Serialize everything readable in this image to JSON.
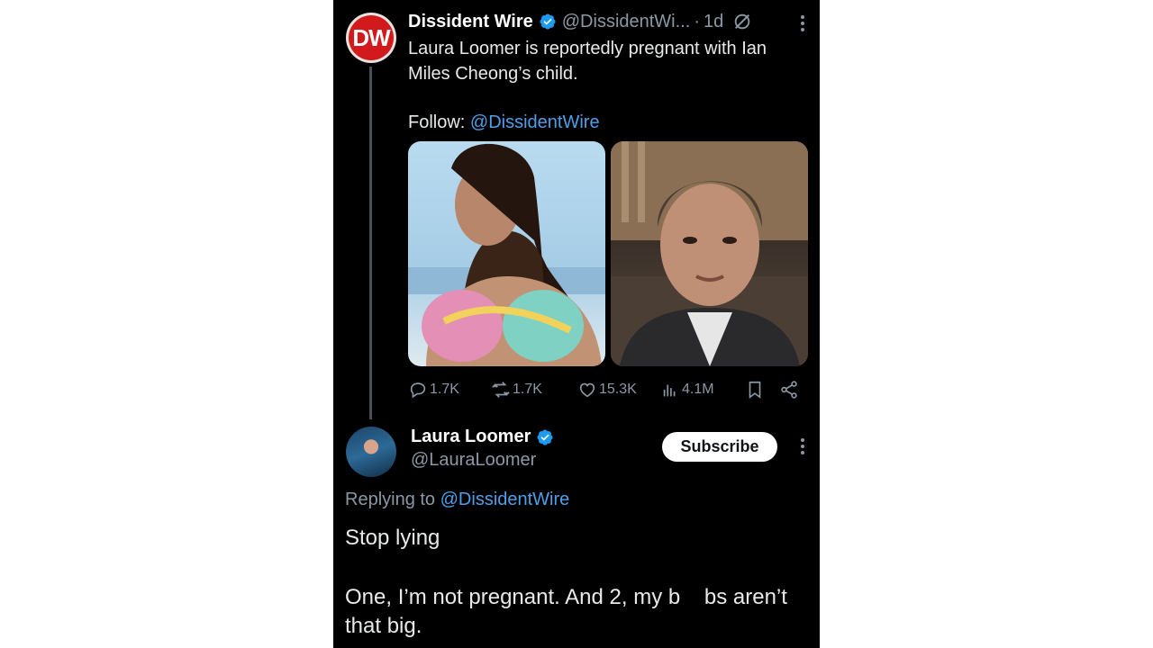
{
  "tweet": {
    "avatar_text": "DW",
    "author_name": "Dissident Wire",
    "author_handle": "@DissidentWi...",
    "separator": "·",
    "time": "1d",
    "text_line1": "Laura Loomer is reportedly pregnant with Ian",
    "text_line2": "Miles Cheong’s child.",
    "follow_prefix": "Follow: ",
    "follow_link": "@DissidentWire",
    "stats": {
      "replies": "1.7K",
      "reposts": "1.7K",
      "likes": "15.3K",
      "views": "4.1M"
    }
  },
  "reply": {
    "author_name": "Laura Loomer",
    "author_handle": "@LauraLoomer",
    "subscribe_label": "Subscribe",
    "replying_prefix": "Replying to ",
    "replying_link": "@DissidentWire",
    "text_line1": "Stop lying",
    "text_line2": "One, I’m not pregnant. And 2, my b    bs aren’t that big."
  },
  "colors": {
    "background": "#000000",
    "link": "#4f9fe8",
    "verified": "#1d9bf0",
    "secondary_text": "#8b98a5"
  }
}
